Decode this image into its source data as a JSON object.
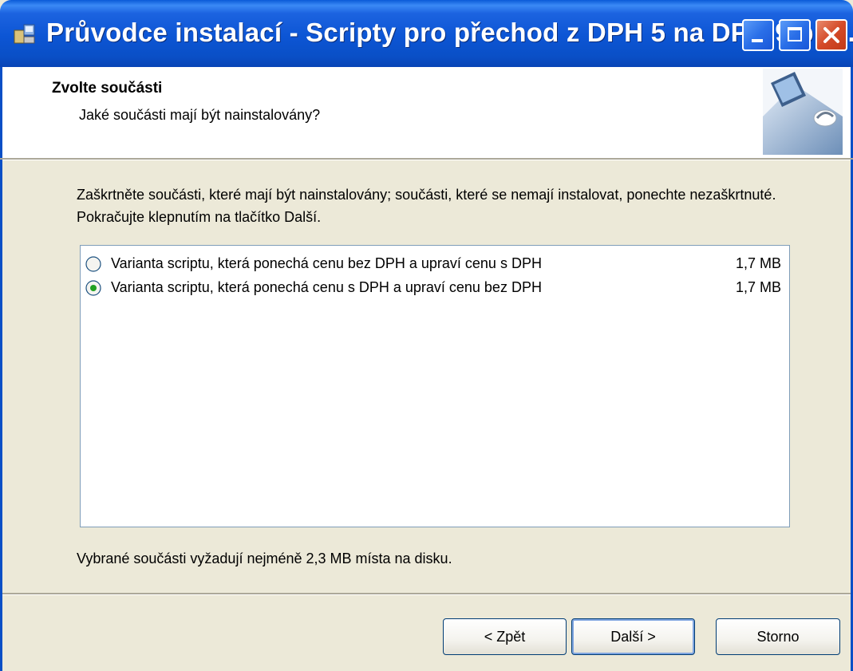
{
  "window": {
    "title": "Průvodce instalací - Scripty pro přechod z DPH 5 na DPH 9 pro...",
    "icon": "installer-icon",
    "controls": [
      "minimize-icon",
      "maximize-icon",
      "close-icon"
    ]
  },
  "header": {
    "title": "Zvolte součásti",
    "subtitle": "Jaké součásti mají být nainstalovány?"
  },
  "body": {
    "instructions": "Zaškrtněte součásti, které mají být nainstalovány; součásti, které se nemají instalovat, ponechte nezaškrtnuté. Pokračujte klepnutím na tlačítko Další.",
    "components": [
      {
        "label": "Varianta scriptu, která ponechá cenu bez DPH a upraví cenu s DPH",
        "size": "1,7 MB",
        "selected": false
      },
      {
        "label": "Varianta scriptu, která ponechá cenu s DPH a upraví cenu bez DPH",
        "size": "1,7 MB",
        "selected": true
      }
    ],
    "space_note": "Vybrané součásti vyžadují nejméně 2,3 MB místa na disku."
  },
  "buttons": {
    "back": "< Zpět",
    "next": "Další >",
    "cancel": "Storno"
  },
  "colors": {
    "titlebar": "#0a4fc6",
    "dialog_bg": "#ece9d8",
    "radio_dot": "#21a121"
  }
}
